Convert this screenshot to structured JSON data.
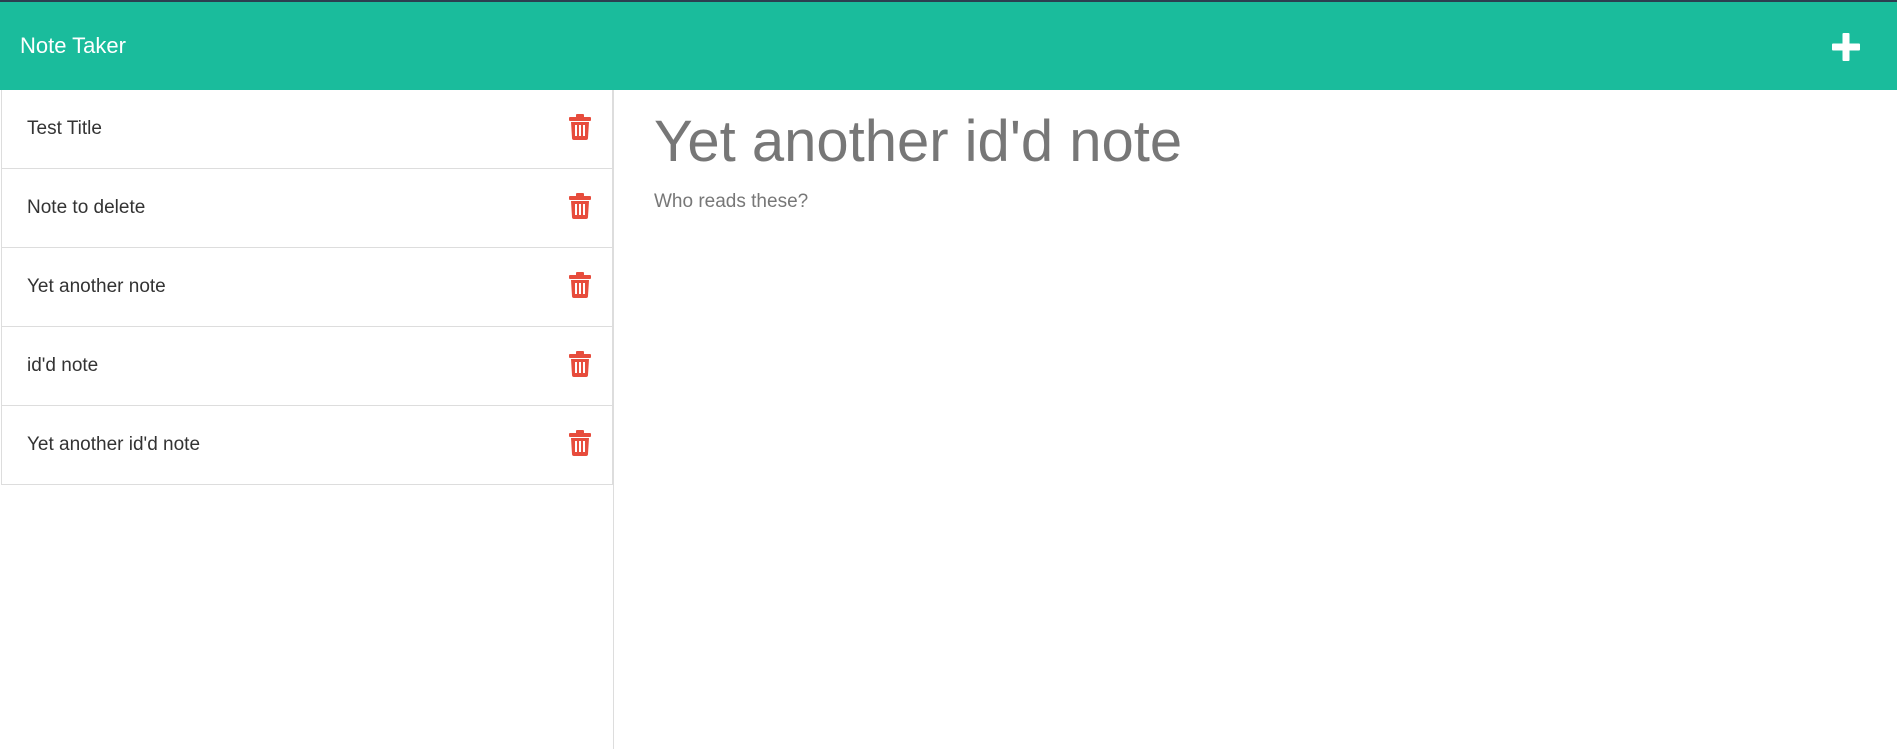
{
  "app": {
    "brand": "Note Taker",
    "colors": {
      "navbar": "#1abc9c",
      "delete": "#e74c3c",
      "text": "#333333",
      "muted": "#777777"
    }
  },
  "navbar": {
    "new_note_icon": "plus-icon"
  },
  "notes": [
    {
      "title": "Test Title",
      "delete_icon": "trash-icon"
    },
    {
      "title": "Note to delete",
      "delete_icon": "trash-icon"
    },
    {
      "title": "Yet another note",
      "delete_icon": "trash-icon"
    },
    {
      "title": "id'd note",
      "delete_icon": "trash-icon"
    },
    {
      "title": "Yet another id'd note",
      "delete_icon": "trash-icon"
    }
  ],
  "editor": {
    "title": "Yet another id'd note",
    "body": "Who reads these?"
  }
}
